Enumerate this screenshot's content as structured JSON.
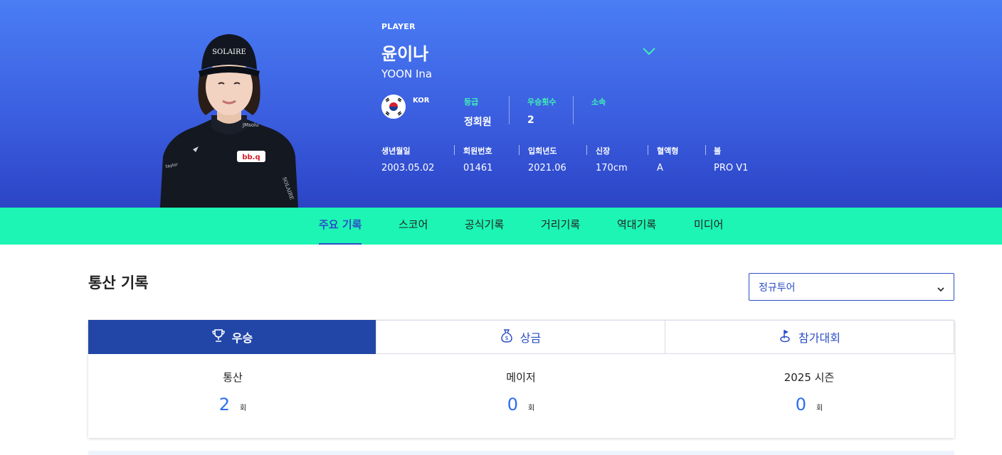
{
  "player": {
    "eyebrow": "PLAYER",
    "name_ko": "윤이나",
    "name_en": "YOON Ina",
    "nation": "KOR",
    "facts": [
      {
        "label": "등급",
        "value": "정회원"
      },
      {
        "label": "우승횟수",
        "value": "2"
      },
      {
        "label": "소속",
        "value": ""
      }
    ],
    "meta": [
      {
        "label": "생년월일",
        "value": "2003.05.02"
      },
      {
        "label": "회원번호",
        "value": "01461"
      },
      {
        "label": "입회년도",
        "value": "2021.06"
      },
      {
        "label": "신장",
        "value": "170cm"
      },
      {
        "label": "혈액형",
        "value": "A"
      },
      {
        "label": "볼",
        "value": "PRO V1"
      }
    ],
    "photo_caption": [
      "SOLAIRE",
      "bb.q",
      "JMsolu",
      "SOLAIRE"
    ]
  },
  "tabs": [
    {
      "label": "주요 기록",
      "active": true
    },
    {
      "label": "스코어"
    },
    {
      "label": "공식기록"
    },
    {
      "label": "거리기록"
    },
    {
      "label": "역대기록"
    },
    {
      "label": "미디어"
    }
  ],
  "section": {
    "title": "통산 기록",
    "select_value": "정규투어"
  },
  "card": {
    "tabs": [
      {
        "label": "우승",
        "icon": "trophy-icon",
        "active": true
      },
      {
        "label": "상금",
        "icon": "money-bag-icon"
      },
      {
        "label": "참가대회",
        "icon": "golf-flag-icon"
      }
    ],
    "stats": [
      {
        "label": "통산",
        "value": "2",
        "unit": "회"
      },
      {
        "label": "메이저",
        "value": "0",
        "unit": "회"
      },
      {
        "label": "2025 시즌",
        "value": "0",
        "unit": "회"
      }
    ]
  },
  "colors": {
    "hero_top": "#4a7df5",
    "hero_bottom": "#2c44c6",
    "tabbar": "#1cf5b3",
    "accent": "#2c4ec6",
    "mint": "#3ff0b5",
    "number_blue": "#2c6ef0"
  }
}
